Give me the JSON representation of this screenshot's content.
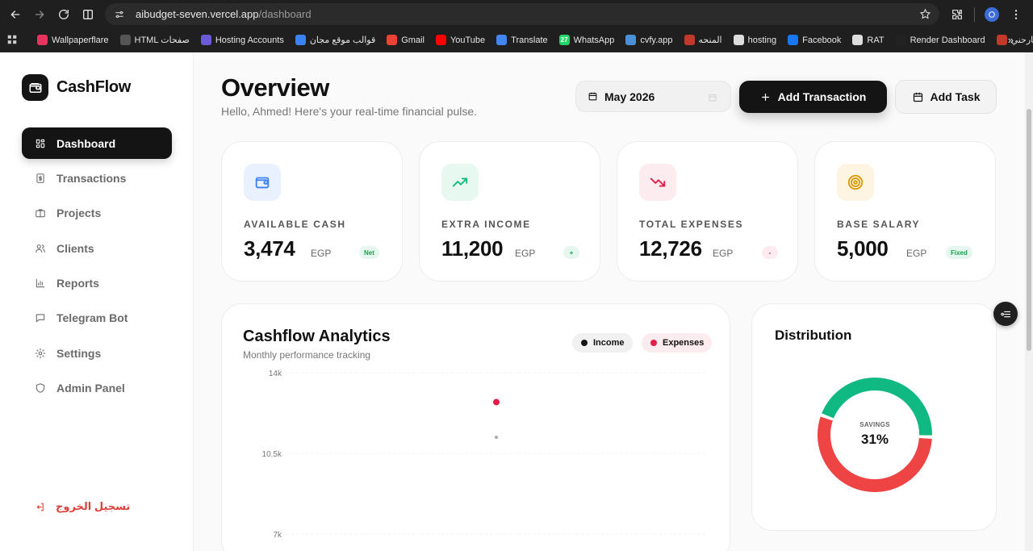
{
  "browser": {
    "url_host": "aibudget-seven.vercel.app",
    "url_path": "/dashboard",
    "bookmarks": [
      {
        "label": "Wallpaperflare",
        "icon": "wallpaperflare-icon",
        "color": "#e6345c"
      },
      {
        "label": "HTML صفحات",
        "icon": "code-icon",
        "color": "#555555"
      },
      {
        "label": "Hosting Accounts",
        "icon": "infinity-icon",
        "color": "#6b5bd6"
      },
      {
        "label": "قوالب موقع مجان",
        "icon": "docs-icon",
        "color": "#3b82f6"
      },
      {
        "label": "Gmail",
        "icon": "gmail-icon",
        "color": "#ea4335"
      },
      {
        "label": "YouTube",
        "icon": "youtube-icon",
        "color": "#ff0000"
      },
      {
        "label": "Translate",
        "icon": "translate-icon",
        "color": "#4285f4"
      },
      {
        "label": "WhatsApp",
        "icon": "whatsapp-icon",
        "color": "#25d366",
        "badge": "27"
      },
      {
        "label": "cvfy.app",
        "icon": "layers-icon",
        "color": "#4a90d9"
      },
      {
        "label": "المنحه",
        "icon": "bookmark-icon",
        "color": "#c0392b"
      },
      {
        "label": "hosting",
        "icon": "globe-icon",
        "color": "#dddddd"
      },
      {
        "label": "Facebook",
        "icon": "facebook-icon",
        "color": "#1877f2"
      },
      {
        "label": "RAT",
        "icon": "github-icon",
        "color": "#dddddd"
      },
      {
        "label": "Render Dashboard",
        "icon": "render-icon",
        "color": "#222222"
      },
      {
        "label": "صارحني",
        "icon": "saraha-icon",
        "color": "#c0392b"
      }
    ]
  },
  "brand": {
    "name": "CashFlow"
  },
  "nav": [
    {
      "label": "Dashboard",
      "icon": "dashboard-icon",
      "active": true
    },
    {
      "label": "Transactions",
      "icon": "receipt-icon"
    },
    {
      "label": "Projects",
      "icon": "briefcase-icon"
    },
    {
      "label": "Clients",
      "icon": "users-icon"
    },
    {
      "label": "Reports",
      "icon": "bar-chart-icon"
    },
    {
      "label": "Telegram Bot",
      "icon": "message-icon"
    },
    {
      "label": "Settings",
      "icon": "gear-icon"
    },
    {
      "label": "Admin Panel",
      "icon": "shield-icon"
    }
  ],
  "logout": {
    "label": "تسجيل الخروج"
  },
  "header": {
    "title": "Overview",
    "subtitle": "Hello, Ahmed! Here's your real-time financial pulse.",
    "month": "May 2026",
    "add_transaction": "Add Transaction",
    "add_task": "Add Task"
  },
  "stats": [
    {
      "label": "AVAILABLE CASH",
      "value": "3,474",
      "unit": "EGP",
      "badge": "Net",
      "accent": "#3b82f6",
      "bg": "#eaf1fe",
      "badge_bg": "#e6f7ef",
      "badge_color": "#16a34a"
    },
    {
      "label": "EXTRA INCOME",
      "value": "11,200",
      "unit": "EGP",
      "badge": "+",
      "accent": "#10b981",
      "bg": "#e7f8f1",
      "badge_bg": "#e6f7ef",
      "badge_color": "#16a34a"
    },
    {
      "label": "TOTAL EXPENSES",
      "value": "12,726",
      "unit": "EGP",
      "badge": "-",
      "accent": "#e11d48",
      "bg": "#fdecef",
      "badge_bg": "#fdecef",
      "badge_color": "#e11d48"
    },
    {
      "label": "BASE SALARY",
      "value": "5,000",
      "unit": "EGP",
      "badge": "Fixed",
      "accent": "#d99a06",
      "bg": "#fdf4e1",
      "badge_bg": "#e6f7ef",
      "badge_color": "#16a34a"
    }
  ],
  "analytics": {
    "title": "Cashflow Analytics",
    "subtitle": "Monthly performance tracking",
    "legend": [
      {
        "name": "Income",
        "color": "#141414",
        "bg": "#f1f1f1"
      },
      {
        "name": "Expenses",
        "color": "#e11d48",
        "bg": "#fdecef"
      }
    ]
  },
  "chart_data": {
    "type": "scatter",
    "y_ticks": [
      "14k",
      "10.5k",
      "7k"
    ],
    "y_tick_values": [
      14000,
      10500,
      7000
    ],
    "ylim": [
      3500,
      14000
    ],
    "grid": true,
    "series": [
      {
        "name": "Expenses",
        "color": "#e11d48",
        "values": [
          12726
        ]
      },
      {
        "name": "Income",
        "color": "#aaaaaa",
        "values": [
          11200
        ]
      }
    ]
  },
  "distribution": {
    "title": "Distribution",
    "center_label": "SAVINGS",
    "center_value": "31%",
    "savings_fraction": 0.31,
    "colors": {
      "savings": "#10b981",
      "expenses": "#ef4444"
    }
  }
}
